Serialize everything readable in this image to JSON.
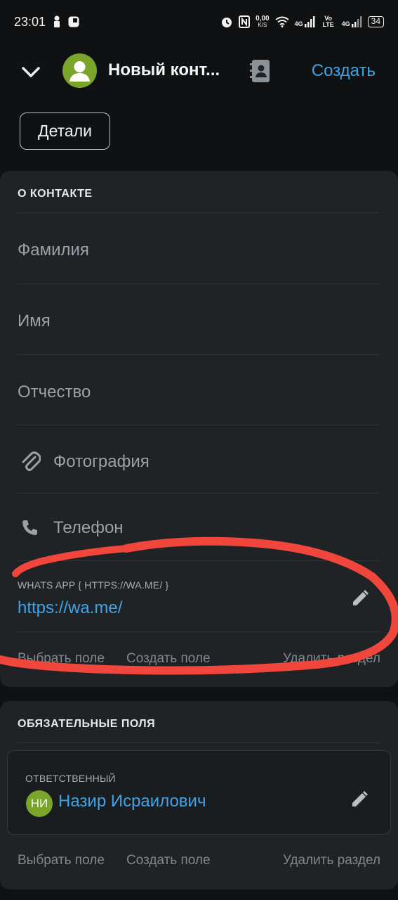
{
  "status_bar": {
    "time": "23:01",
    "net_speed": "0,00",
    "net_speed_unit": "K/S",
    "sim1": "4G",
    "volte": "Vo LTE",
    "sim2": "4G",
    "battery": "34"
  },
  "header": {
    "title": "Новый конт...",
    "create_label": "Создать"
  },
  "details_label": "Детали",
  "about": {
    "section_title": "О КОНТАКТЕ",
    "fields": {
      "last_name": "Фамилия",
      "first_name": "Имя",
      "middle_name": "Отчество",
      "photo": "Фотография",
      "phone": "Телефон"
    },
    "whatsapp": {
      "label": "WHATS APP { HTTPS://WA.ME/ }",
      "value": "https://wa.me/"
    },
    "actions": {
      "select": "Выбрать поле",
      "create": "Создать поле",
      "delete": "Удалить раздел"
    }
  },
  "required": {
    "section_title": "ОБЯЗАТЕЛЬНЫЕ ПОЛЯ",
    "responsible_label": "ОТВЕТСТВЕННЫЙ",
    "responsible_initials": "НИ",
    "responsible_name": "Назир Исраилович",
    "actions": {
      "select": "Выбрать поле",
      "create": "Создать поле",
      "delete": "Удалить раздел"
    }
  },
  "colors": {
    "background": "#0f1112",
    "card": "#1f2326",
    "accent_link": "#3fa3e6",
    "avatar_green": "#7aa52a",
    "annotation_red": "#f0463c"
  },
  "icons": [
    "chevron-down-icon",
    "avatar-icon",
    "address-book-icon",
    "paperclip-icon",
    "phone-icon",
    "pencil-icon"
  ]
}
